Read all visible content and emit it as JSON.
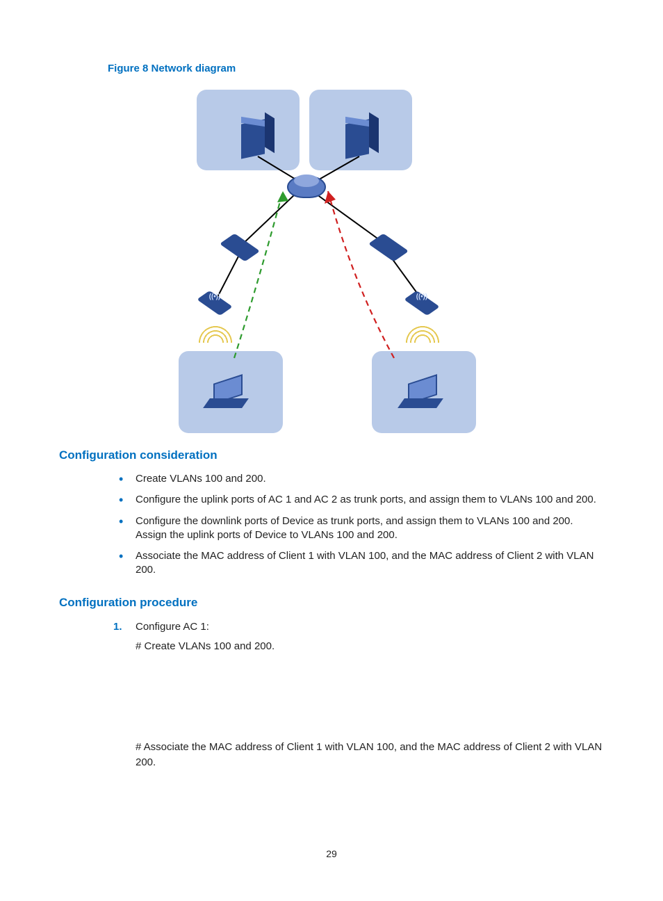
{
  "figure": {
    "caption": "Figure 8 Network diagram"
  },
  "sections": {
    "consideration": {
      "title": "Configuration consideration",
      "bullets": [
        "Create VLANs 100 and 200.",
        "Configure the uplink ports of AC 1 and AC 2 as trunk ports, and assign them to VLANs 100 and 200.",
        "Configure the downlink ports of Device as trunk ports, and assign them to VLANs 100 and 200. Assign the uplink ports of Device to VLANs 100 and 200.",
        "Associate the MAC address of Client 1 with VLAN 100, and the MAC address of Client 2 with VLAN 200."
      ]
    },
    "procedure": {
      "title": "Configuration procedure",
      "step1": {
        "number": "1.",
        "label": "Configure AC 1:",
        "line1": "# Create VLANs 100 and 200.",
        "line2": "# Associate the MAC address of Client 1 with VLAN 100, and the MAC address of Client 2 with VLAN 200."
      }
    }
  },
  "page_number": "29"
}
